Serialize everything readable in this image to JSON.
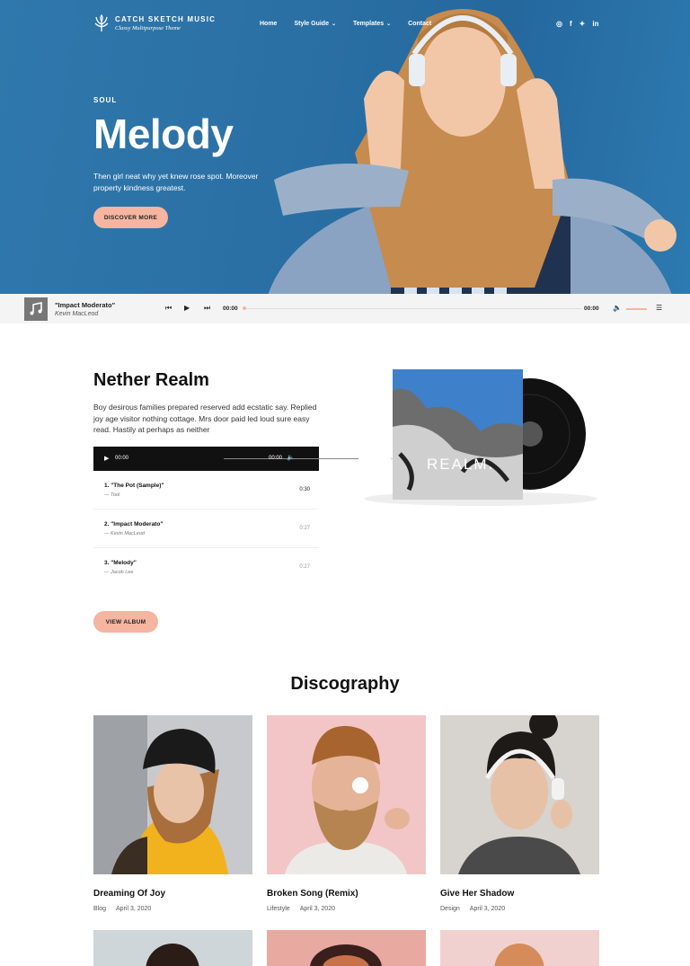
{
  "header": {
    "logo_title": "CATCH SKETCH MUSIC",
    "logo_tagline": "Classy Multipurpose Theme",
    "nav": [
      {
        "label": "Home",
        "dropdown": false
      },
      {
        "label": "Style Guide",
        "dropdown": true
      },
      {
        "label": "Templates",
        "dropdown": true
      },
      {
        "label": "Contact",
        "dropdown": false
      }
    ],
    "social": [
      "instagram-icon",
      "facebook-icon",
      "twitter-icon",
      "linkedin-icon"
    ]
  },
  "hero": {
    "kicker": "SOUL",
    "title": "Melody",
    "text": "Then girl neat why yet knew rose spot. Moreover property kindness greatest.",
    "button": "DISCOVER MORE"
  },
  "player": {
    "track_title": "\"Impact Moderato\"",
    "artist": "Kevin MacLeod",
    "time_current": "00:00",
    "time_total": "00:00",
    "progress": 0
  },
  "album": {
    "title": "Nether Realm",
    "description": "Boy desirous families prepared reserved add ecstatic say. Replied joy age visitor nothing cottage. Mrs door paid led loud sure easy read. Hastily at perhaps as neither",
    "audio_current": "00:00",
    "audio_total": "00:00",
    "cover_text": "REALM.",
    "tracks": [
      {
        "name": "1. \"The Pot (Sample)\"",
        "artist": "— Tool",
        "duration": "0:30"
      },
      {
        "name": "2. \"Impact Moderato\"",
        "artist": "— Kevin MacLeod",
        "duration": "0:27"
      },
      {
        "name": "3. \"Melody\"",
        "artist": "— Jacob Lee",
        "duration": "0:27"
      }
    ],
    "button": "VIEW ALBUM"
  },
  "discography": {
    "title": "Discography",
    "cards": [
      {
        "title": "Dreaming Of Joy",
        "category": "Blog",
        "date": "April 3, 2020"
      },
      {
        "title": "Broken Song (Remix)",
        "category": "Lifestyle",
        "date": "April 3, 2020"
      },
      {
        "title": "Give Her Shadow",
        "category": "Design",
        "date": "April 3, 2020"
      }
    ]
  },
  "colors": {
    "hero_blue": "#2a6fa3",
    "accent_peach": "#f5b5a0",
    "dark": "#111111"
  }
}
